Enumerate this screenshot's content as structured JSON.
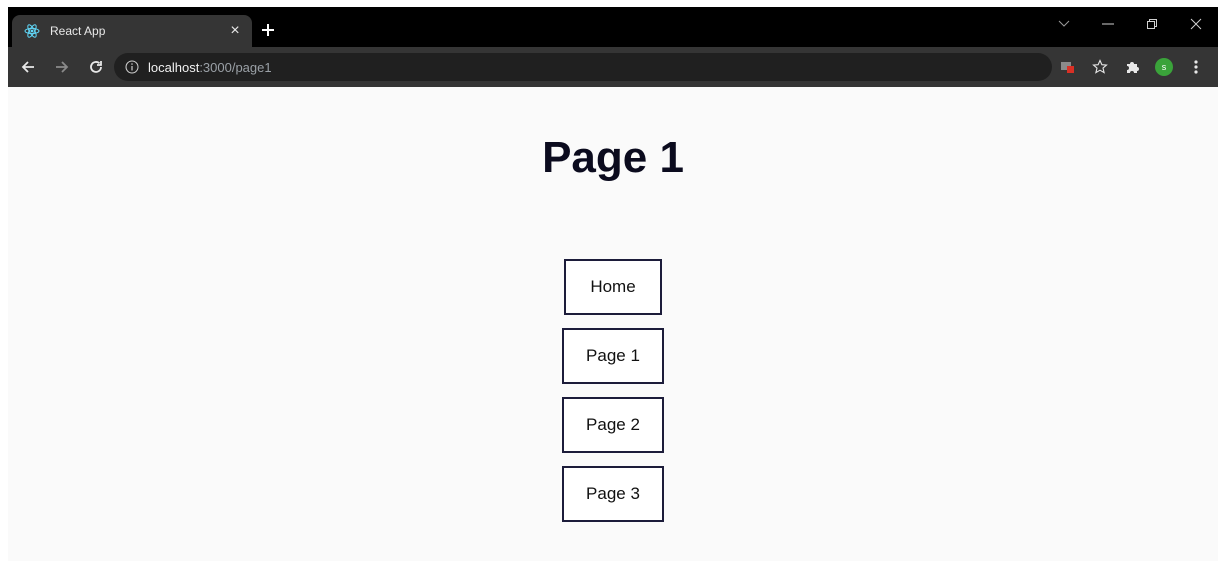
{
  "browser": {
    "tab": {
      "title": "React App",
      "favicon": "react-icon",
      "close_glyph": "×"
    },
    "new_tab_icon": "plus-icon",
    "window_controls": [
      "chevron-down-icon",
      "minimize-icon",
      "restore-icon",
      "close-icon"
    ],
    "toolbar": {
      "back_icon": "arrow-left-icon",
      "forward_icon": "arrow-right-icon",
      "reload_icon": "reload-icon",
      "url_host": "localhost",
      "url_rest": ":3000/page1",
      "site_info_icon": "info-icon",
      "right_icons": [
        "media-blocked-icon",
        "star-icon",
        "puzzle-icon"
      ],
      "profile_initial": "s",
      "menu_icon": "kebab-menu-icon"
    }
  },
  "page": {
    "heading": "Page 1",
    "nav_links": [
      "Home",
      "Page 1",
      "Page 2",
      "Page 3"
    ]
  },
  "colors": {
    "tab_bar": "#000000",
    "toolbar": "#353535",
    "omnibox": "#202020",
    "page_bg": "#fafafa",
    "button_border": "#1c1c3a",
    "heading": "#0b0b1e",
    "profile": "#3aa33a"
  }
}
